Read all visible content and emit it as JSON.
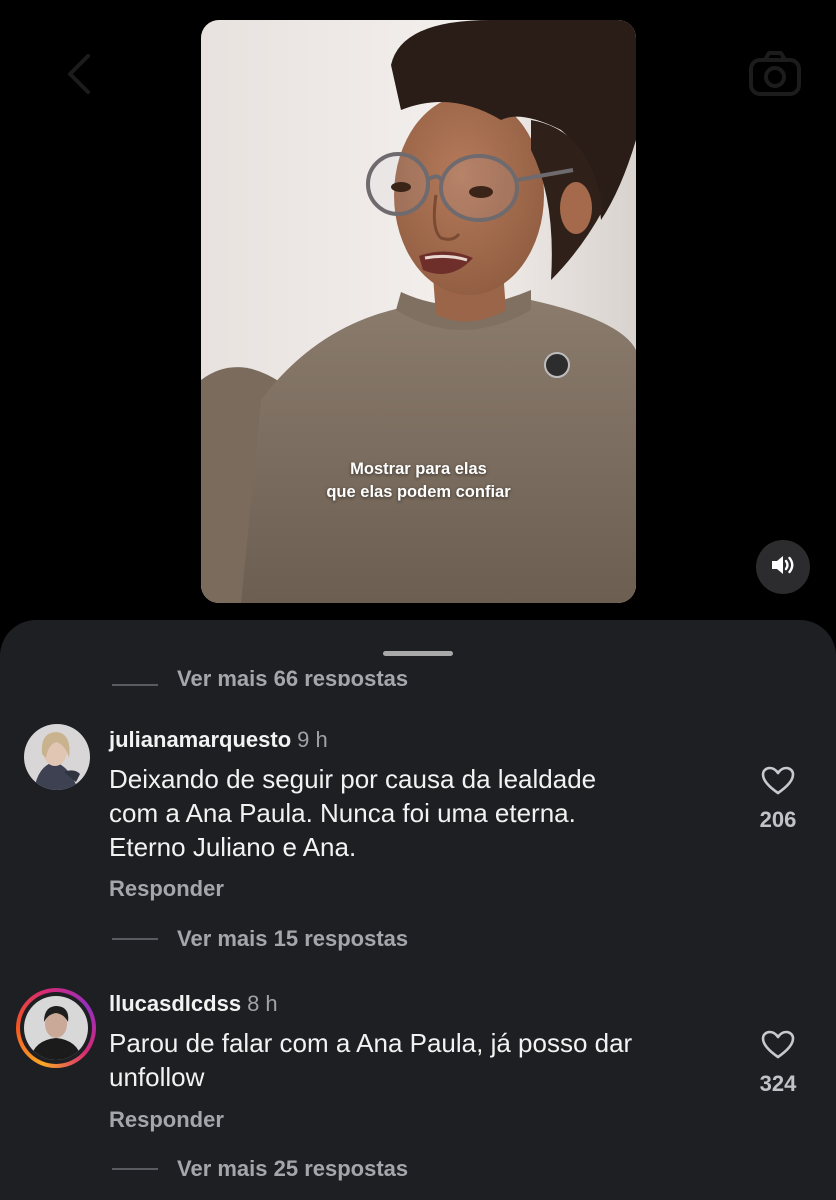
{
  "video": {
    "caption_line1": "Mostrar para elas",
    "caption_line2": "que elas podem confiar"
  },
  "icons": {
    "back": "chevron-left-icon",
    "camera": "camera-icon",
    "sound": "speaker-on-icon",
    "like": "heart-outline-icon"
  },
  "comments": {
    "top_more": "Ver mais 66 respostas",
    "items": [
      {
        "username": "julianamarquesto",
        "time": "9 h",
        "lines": [
          "Deixando de seguir por causa da lealdade",
          "com a Ana Paula. Nunca foi uma eterna.",
          "Eterno Juliano e Ana."
        ],
        "likes": "206",
        "reply_label": "Responder",
        "more_replies": "Ver mais 15 respostas"
      },
      {
        "username": "llucasdlcdss",
        "time": "8 h",
        "lines": [
          "Parou de falar com a Ana Paula, já posso dar",
          "unfollow"
        ],
        "likes": "324",
        "reply_label": "Responder",
        "more_replies": "Ver mais 25 respostas"
      }
    ]
  },
  "colors": {
    "background": "#000000",
    "sheet": "#1e1f23",
    "text_primary": "#f2f2f2",
    "text_secondary": "#a5a6ab",
    "story_ring_start": "#f9a825",
    "story_ring_end": "#d62976"
  }
}
